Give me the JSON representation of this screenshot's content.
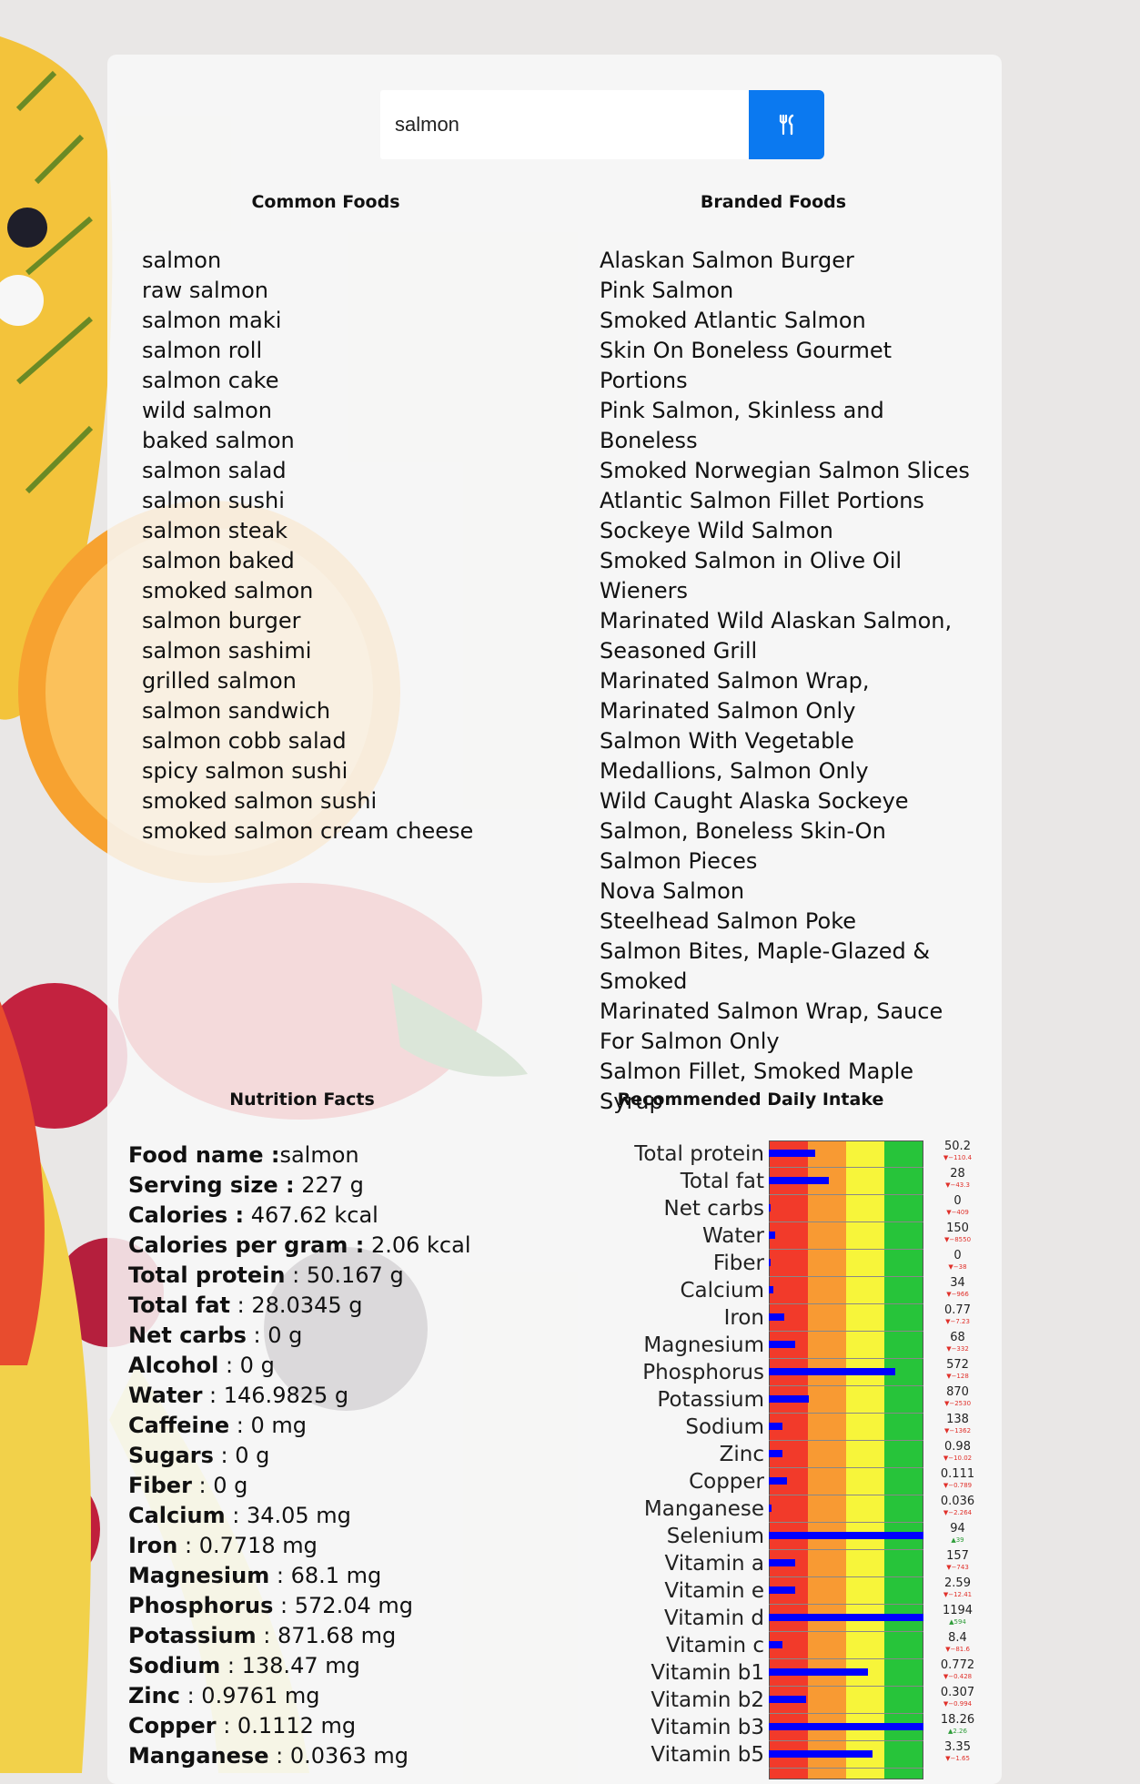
{
  "search": {
    "value": "salmon",
    "button_icon": "utensils-icon"
  },
  "colors": {
    "accent": "#0b79f0",
    "bar": "#0000ff",
    "zone_red": "#f23a2a",
    "zone_orange": "#f89a33",
    "zone_yellow": "#f7f53a",
    "zone_green": "#27c43a",
    "diff_down": "#e0302a",
    "diff_up": "#2f9d3a"
  },
  "common_foods": {
    "title": "Common Foods",
    "items": [
      "salmon",
      "raw salmon",
      "salmon maki",
      "salmon roll",
      "salmon cake",
      "wild salmon",
      "baked salmon",
      "salmon salad",
      "salmon sushi",
      "salmon steak",
      "salmon baked",
      "smoked salmon",
      "salmon burger",
      "salmon sashimi",
      "grilled salmon",
      "salmon sandwich",
      "salmon cobb salad",
      "spicy salmon sushi",
      "smoked salmon sushi",
      "smoked salmon cream cheese"
    ]
  },
  "branded_foods": {
    "title": "Branded Foods",
    "items": [
      "Alaskan Salmon Burger",
      "Pink Salmon",
      "Smoked Atlantic Salmon",
      "Skin On Boneless Gourmet Portions",
      "Pink Salmon, Skinless and Boneless",
      "Smoked Norwegian Salmon Slices",
      "Atlantic Salmon Fillet Portions",
      "Sockeye Wild Salmon",
      "Smoked Salmon in Olive Oil Wieners",
      "Marinated Wild Alaskan Salmon, Seasoned Grill",
      "Marinated Salmon Wrap, Marinated Salmon Only",
      "Salmon With Vegetable Medallions, Salmon Only",
      "Wild Caught Alaska Sockeye Salmon, Boneless Skin-On",
      "Salmon Pieces",
      "Nova Salmon",
      "Steelhead Salmon Poke",
      "Salmon Bites, Maple-Glazed & Smoked",
      "Marinated Salmon Wrap, Sauce For Salmon Only",
      "Salmon Fillet, Smoked Maple Syrup"
    ]
  },
  "nutrition_facts": {
    "title": "Nutrition Facts",
    "rows": [
      {
        "label": "Food name :",
        "value": "salmon"
      },
      {
        "label": "Serving size :",
        "value": " 227 g"
      },
      {
        "label": "Calories :",
        "value": " 467.62 kcal"
      },
      {
        "label": "Calories per gram :",
        "value": " 2.06 kcal"
      },
      {
        "label": "Total protein",
        "value": " : 50.167 g"
      },
      {
        "label": "Total fat",
        "value": " : 28.0345 g"
      },
      {
        "label": "Net carbs",
        "value": " : 0 g"
      },
      {
        "label": "Alcohol",
        "value": " : 0 g"
      },
      {
        "label": "Water",
        "value": " : 146.9825 g"
      },
      {
        "label": "Caffeine",
        "value": " : 0 mg"
      },
      {
        "label": "Sugars",
        "value": " : 0 g"
      },
      {
        "label": "Fiber",
        "value": " : 0 g"
      },
      {
        "label": "Calcium",
        "value": " : 34.05 mg"
      },
      {
        "label": "Iron",
        "value": " : 0.7718 mg"
      },
      {
        "label": "Magnesium",
        "value": " : 68.1 mg"
      },
      {
        "label": "Phosphorus",
        "value": " : 572.04 mg"
      },
      {
        "label": "Potassium",
        "value": " : 871.68 mg"
      },
      {
        "label": "Sodium",
        "value": " : 138.47 mg"
      },
      {
        "label": "Zinc",
        "value": " : 0.9761 mg"
      },
      {
        "label": "Copper",
        "value": " : 0.1112 mg"
      },
      {
        "label": "Manganese",
        "value": " : 0.0363 mg"
      }
    ]
  },
  "daily_intake": {
    "title": "Recommended Daily Intake",
    "rows": [
      {
        "label": "Total protein",
        "value": "50.2",
        "diff": "▼−110.4",
        "dir": "down",
        "fraction": 0.3
      },
      {
        "label": "Total fat",
        "value": "28",
        "diff": "▼−43.3",
        "dir": "down",
        "fraction": 0.39
      },
      {
        "label": "Net carbs",
        "value": "0",
        "diff": "▼−409",
        "dir": "down",
        "fraction": 0
      },
      {
        "label": "Water",
        "value": "150",
        "diff": "▼−8550",
        "dir": "down",
        "fraction": 0.04
      },
      {
        "label": "Fiber",
        "value": "0",
        "diff": "▼−38",
        "dir": "down",
        "fraction": 0
      },
      {
        "label": "Calcium",
        "value": "34",
        "diff": "▼−966",
        "dir": "down",
        "fraction": 0.03
      },
      {
        "label": "Iron",
        "value": "0.77",
        "diff": "▼−7.23",
        "dir": "down",
        "fraction": 0.1
      },
      {
        "label": "Magnesium",
        "value": "68",
        "diff": "▼−332",
        "dir": "down",
        "fraction": 0.17
      },
      {
        "label": "Phosphorus",
        "value": "572",
        "diff": "▼−128",
        "dir": "down",
        "fraction": 0.82
      },
      {
        "label": "Potassium",
        "value": "870",
        "diff": "▼−2530",
        "dir": "down",
        "fraction": 0.26
      },
      {
        "label": "Sodium",
        "value": "138",
        "diff": "▼−1362",
        "dir": "down",
        "fraction": 0.09
      },
      {
        "label": "Zinc",
        "value": "0.98",
        "diff": "▼−10.02",
        "dir": "down",
        "fraction": 0.09
      },
      {
        "label": "Copper",
        "value": "0.111",
        "diff": "▼−0.789",
        "dir": "down",
        "fraction": 0.12
      },
      {
        "label": "Manganese",
        "value": "0.036",
        "diff": "▼−2.264",
        "dir": "down",
        "fraction": 0.02
      },
      {
        "label": "Selenium",
        "value": "94",
        "diff": "▲39",
        "dir": "up",
        "fraction": 1.0
      },
      {
        "label": "Vitamin a",
        "value": "157",
        "diff": "▼−743",
        "dir": "down",
        "fraction": 0.17
      },
      {
        "label": "Vitamin e",
        "value": "2.59",
        "diff": "▼−12.41",
        "dir": "down",
        "fraction": 0.17
      },
      {
        "label": "Vitamin d",
        "value": "1194",
        "diff": "▲594",
        "dir": "up",
        "fraction": 1.0
      },
      {
        "label": "Vitamin c",
        "value": "8.4",
        "diff": "▼−81.6",
        "dir": "down",
        "fraction": 0.09
      },
      {
        "label": "Vitamin b1",
        "value": "0.772",
        "diff": "▼−0.428",
        "dir": "down",
        "fraction": 0.64
      },
      {
        "label": "Vitamin b2",
        "value": "0.307",
        "diff": "▼−0.994",
        "dir": "down",
        "fraction": 0.24
      },
      {
        "label": "Vitamin b3",
        "value": "18.26",
        "diff": "▲2.26",
        "dir": "up",
        "fraction": 1.0
      },
      {
        "label": "Vitamin b5",
        "value": "3.35",
        "diff": "▼−1.65",
        "dir": "down",
        "fraction": 0.67
      }
    ]
  }
}
